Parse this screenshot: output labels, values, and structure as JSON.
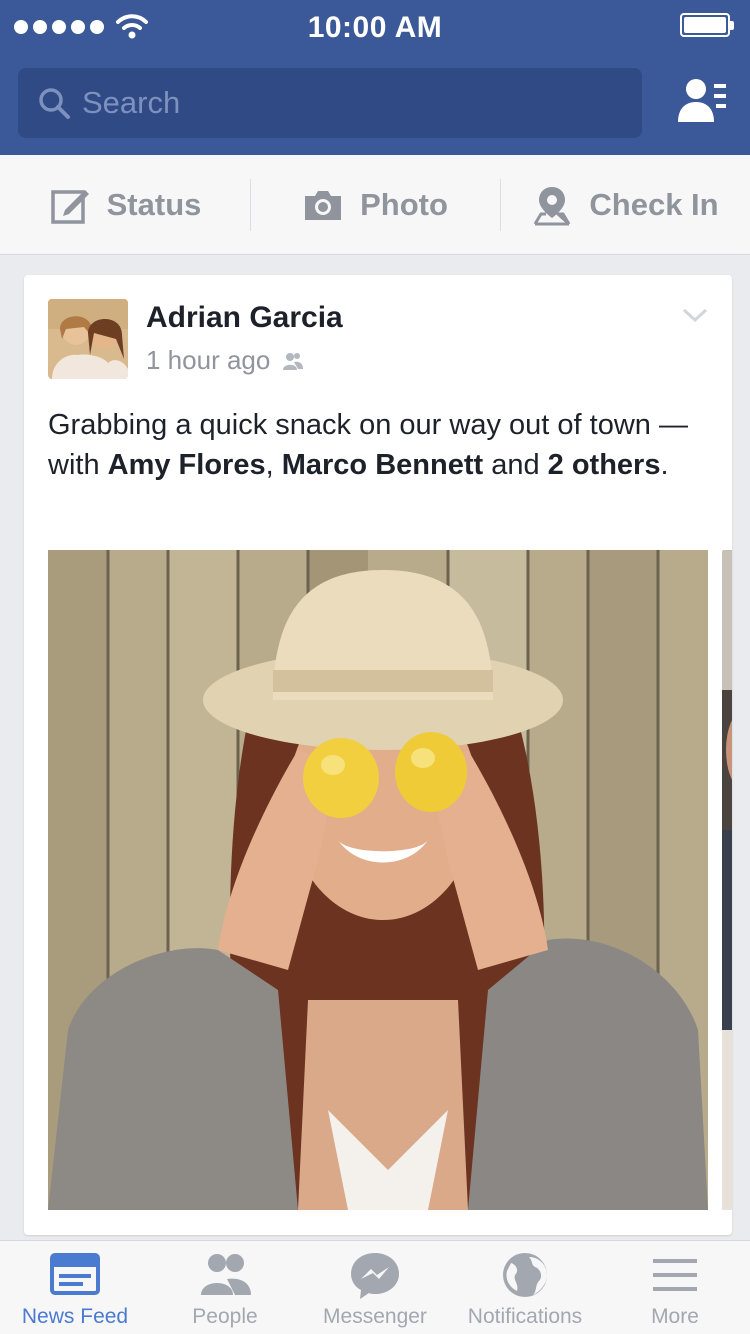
{
  "status_bar": {
    "time": "10:00 AM"
  },
  "header": {
    "search_placeholder": "Search"
  },
  "composer": {
    "items": [
      {
        "label": "Status",
        "icon": "edit-icon"
      },
      {
        "label": "Photo",
        "icon": "camera-icon"
      },
      {
        "label": "Check In",
        "icon": "location-pin-icon"
      }
    ]
  },
  "story": {
    "author": "Adrian Garcia",
    "time": "1 hour ago",
    "audience_icon": "friends-audience-icon",
    "text_prefix": "Grabbing a quick snack on our way out of town — with ",
    "tagged_1": "Amy Flores",
    "separator": ", ",
    "tagged_2": "Marco Bennett",
    "text_and": " and ",
    "tagged_others": "2 others",
    "text_suffix": "."
  },
  "tabbar": {
    "active_index": 0,
    "tabs": [
      {
        "label": "News Feed",
        "icon": "news-feed-icon"
      },
      {
        "label": "People",
        "icon": "people-icon"
      },
      {
        "label": "Messenger",
        "icon": "messenger-icon"
      },
      {
        "label": "Notifications",
        "icon": "globe-icon"
      },
      {
        "label": "More",
        "icon": "menu-icon"
      }
    ]
  },
  "colors": {
    "brand_blue": "#3b5998",
    "active_tab": "#4a7bd0",
    "muted": "#90949c"
  }
}
